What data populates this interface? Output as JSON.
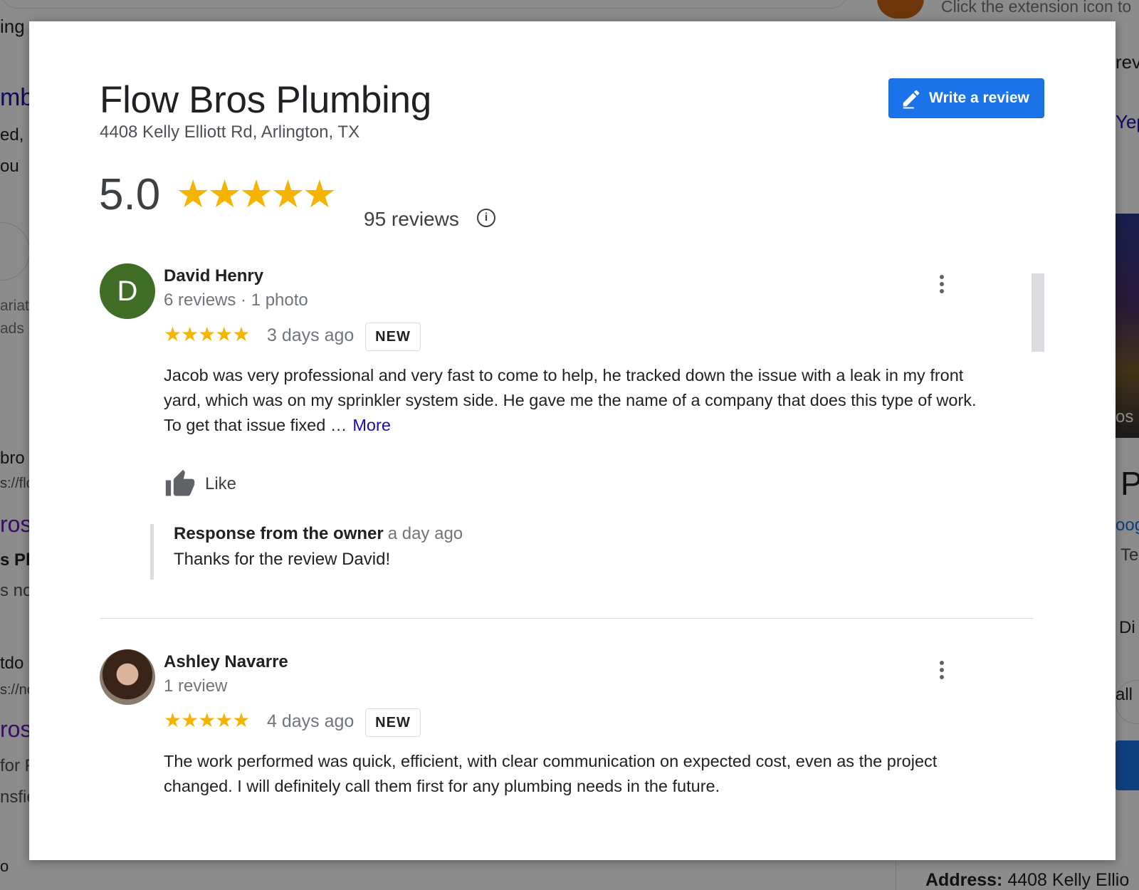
{
  "background": {
    "top_left_text": "ing",
    "top_left_text2": "Plumb...",
    "extension_hint": "Click the extension icon to",
    "left_fragments": [
      "mb",
      "ed, I",
      "ou",
      "ariat",
      "ads",
      "bro",
      "s://flo",
      "ros",
      "s Pl",
      "s no",
      "tdo",
      "s://no",
      "ros",
      "for F",
      "nsfie",
      "o"
    ],
    "right_fragments": [
      "rev",
      "Yep",
      "os",
      "P",
      "oog",
      "Te",
      "Di",
      "all"
    ],
    "bottom_address_label": "Address:",
    "bottom_address_value": "4408 Kelly Ellio"
  },
  "business": {
    "name": "Flow Bros Plumbing",
    "address": "4408 Kelly Elliott Rd, Arlington, TX",
    "rating": "5.0",
    "stars": "★★★★★",
    "reviews_count": "95 reviews",
    "info_icon": "i",
    "write_review_label": "Write a review"
  },
  "reviews": [
    {
      "avatar_letter": "D",
      "name": "David Henry",
      "meta": "6 reviews · 1 photo",
      "stars": "★★★★★",
      "time": "3 days ago",
      "badge": "NEW",
      "text": "Jacob was very professional and very fast to come to help, he tracked down the issue with a leak in my front yard, which was on my sprinkler system side. He gave me the name of a company that does this type of work. To get that issue fixed …",
      "more_label": "More",
      "like_label": "Like",
      "owner_response": {
        "title": "Response from the owner",
        "time": "a day ago",
        "text": "Thanks for the review David!"
      }
    },
    {
      "name": "Ashley Navarre",
      "meta": "1 review",
      "stars": "★★★★★",
      "time": "4 days ago",
      "badge": "NEW",
      "text": "The work performed was quick, efficient, with clear communication on expected cost, even as the project changed. I will definitely call them first for any plumbing needs in the future."
    }
  ],
  "colors": {
    "accent_blue": "#1a73e8",
    "star_yellow": "#f4b400",
    "link_blue": "#1a0dab",
    "avatar_green": "#3f6d25"
  },
  "icons": {
    "write_review": "pencil-icon",
    "info": "info-icon",
    "menu": "more-vert-icon",
    "like": "thumbs-up-icon"
  }
}
